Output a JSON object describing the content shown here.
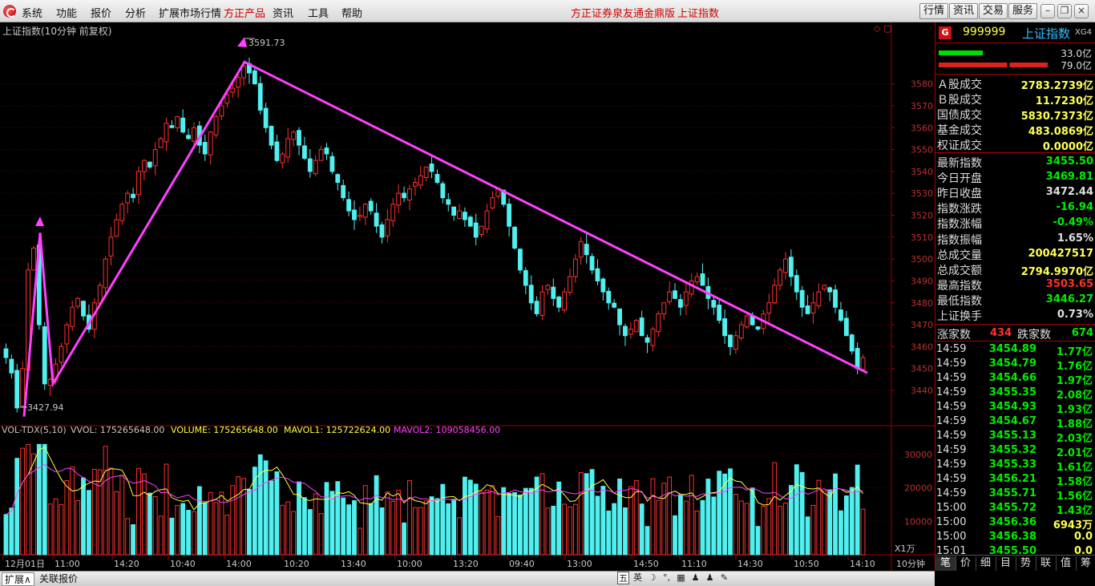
{
  "menu": {
    "items": [
      "系统",
      "功能",
      "报价",
      "分析",
      "扩展市场行情",
      "方正产品",
      "资讯",
      "工具",
      "帮助"
    ],
    "highlight": "方正产品",
    "title_left": "方正证券泉友通金鼎版",
    "title_right": "上证指数",
    "buttons": [
      "行情",
      "资讯",
      "交易",
      "服务"
    ]
  },
  "chart": {
    "title": "上证指数(10分钟 前复权)",
    "high_label": "3591.73",
    "low_label": "3427.94",
    "vol_header": {
      "name": "VOL-TDX(5,10)",
      "vvol": "VVOL: 175265648.00",
      "volume": "VOLUME: 175265648.00",
      "mavol1": "MAVOL1: 125722624.00",
      "mavol2": "MAVOL2: 109058456.00"
    },
    "unit_label": "X1万",
    "period_label": "10分钟",
    "colors": {
      "up": "#ff3030",
      "down": "#50f0f0",
      "trend": "#ff40ff",
      "ma1": "#ffff40",
      "ma2": "#ff40ff",
      "grid": "#6a0000"
    }
  },
  "chart_data": [
    {
      "type": "candlestick",
      "title": "上证指数(10分钟 前复权)",
      "y_ticks": [
        3440,
        3450,
        3460,
        3470,
        3480,
        3490,
        3500,
        3510,
        3520,
        3530,
        3540,
        3550,
        3560,
        3570,
        3580
      ],
      "ylim": [
        3425,
        3600
      ],
      "x_ticks": [
        "12月01日",
        "11:00",
        "14:20",
        "10:40",
        "14:00",
        "10:20",
        "13:40",
        "10:00",
        "13:20",
        "09:40",
        "13:00",
        "14:50",
        "11:10",
        "14:30",
        "10:50",
        "14:10"
      ],
      "close_path": [
        3455,
        3448,
        3432,
        3450,
        3495,
        3505,
        3470,
        3443,
        3445,
        3452,
        3460,
        3470,
        3478,
        3482,
        3474,
        3468,
        3480,
        3488,
        3500,
        3510,
        3518,
        3525,
        3530,
        3528,
        3540,
        3545,
        3542,
        3550,
        3555,
        3562,
        3560,
        3565,
        3558,
        3555,
        3560,
        3552,
        3548,
        3558,
        3565,
        3570,
        3575,
        3578,
        3583,
        3588,
        3585,
        3580,
        3568,
        3560,
        3552,
        3545,
        3548,
        3555,
        3558,
        3552,
        3546,
        3540,
        3545,
        3550,
        3548,
        3540,
        3535,
        3528,
        3522,
        3518,
        3520,
        3525,
        3522,
        3515,
        3510,
        3518,
        3525,
        3530,
        3528,
        3532,
        3535,
        3538,
        3542,
        3540,
        3535,
        3528,
        3525,
        3520,
        3522,
        3518,
        3515,
        3510,
        3515,
        3522,
        3528,
        3532,
        3525,
        3515,
        3505,
        3495,
        3488,
        3480,
        3475,
        3485,
        3488,
        3482,
        3478,
        3485,
        3492,
        3500,
        3508,
        3502,
        3495,
        3490,
        3485,
        3480,
        3478,
        3470,
        3465,
        3468,
        3472,
        3465,
        3462,
        3468,
        3475,
        3480,
        3485,
        3482,
        3478,
        3485,
        3490,
        3492,
        3488,
        3482,
        3478,
        3472,
        3465,
        3460,
        3465,
        3470,
        3474,
        3470,
        3468,
        3475,
        3480,
        3488,
        3495,
        3500,
        3492,
        3485,
        3478,
        3475,
        3480,
        3485,
        3488,
        3485,
        3478,
        3472,
        3465,
        3458,
        3450,
        3455
      ],
      "annotations": [
        "3591.73",
        "3427.94"
      ],
      "last": 3455.5
    },
    {
      "type": "bar",
      "title": "VOL-TDX(5,10)",
      "y_ticks": [
        10000,
        20000,
        30000
      ],
      "unit": "X1万",
      "ylim": [
        0,
        35000
      ]
    }
  ],
  "panel": {
    "code": "999999",
    "name": "上证指数",
    "tag": "XG4",
    "bar_top_value": "33.0亿",
    "bar_bottom_value": "79.0亿",
    "stats": [
      {
        "k": "Ａ股成交",
        "v": "2783.2739亿",
        "c": "y"
      },
      {
        "k": "Ｂ股成交",
        "v": "11.7230亿",
        "c": "y"
      },
      {
        "k": "国债成交",
        "v": "5830.7373亿",
        "c": "y"
      },
      {
        "k": "基金成交",
        "v": "483.0869亿",
        "c": "y"
      },
      {
        "k": "权证成交",
        "v": "0.0000亿",
        "c": "y"
      }
    ],
    "quote": [
      {
        "k": "最新指数",
        "v": "3455.50",
        "c": "g"
      },
      {
        "k": "今日开盘",
        "v": "3469.81",
        "c": "g"
      },
      {
        "k": "昨日收盘",
        "v": "3472.44",
        "c": "w"
      },
      {
        "k": "指数涨跌",
        "v": "-16.94",
        "c": "g"
      },
      {
        "k": "指数涨幅",
        "v": "-0.49%",
        "c": "g"
      },
      {
        "k": "指数振幅",
        "v": "1.65%",
        "c": "w"
      },
      {
        "k": "总成交量",
        "v": "200427517",
        "c": "y"
      },
      {
        "k": "总成交额",
        "v": "2794.9970亿",
        "c": "y"
      },
      {
        "k": "最高指数",
        "v": "3503.65",
        "c": "r"
      },
      {
        "k": "最低指数",
        "v": "3446.27",
        "c": "g"
      },
      {
        "k": "上证换手",
        "v": "0.73%",
        "c": "w"
      }
    ],
    "up_label": "涨家数",
    "up_count": "434",
    "down_label": "跌家数",
    "down_count": "674",
    "ticks": [
      {
        "t": "14:59",
        "p": "3454.89",
        "v": "1.77亿",
        "c": "g"
      },
      {
        "t": "14:59",
        "p": "3454.79",
        "v": "1.76亿",
        "c": "g"
      },
      {
        "t": "14:59",
        "p": "3454.66",
        "v": "1.97亿",
        "c": "g"
      },
      {
        "t": "14:59",
        "p": "3455.35",
        "v": "2.08亿",
        "c": "g"
      },
      {
        "t": "14:59",
        "p": "3454.93",
        "v": "1.93亿",
        "c": "g"
      },
      {
        "t": "14:59",
        "p": "3454.67",
        "v": "1.88亿",
        "c": "g"
      },
      {
        "t": "14:59",
        "p": "3455.13",
        "v": "2.03亿",
        "c": "g"
      },
      {
        "t": "14:59",
        "p": "3455.32",
        "v": "2.01亿",
        "c": "g"
      },
      {
        "t": "14:59",
        "p": "3455.33",
        "v": "1.61亿",
        "c": "g"
      },
      {
        "t": "14:59",
        "p": "3456.21",
        "v": "1.58亿",
        "c": "g"
      },
      {
        "t": "14:59",
        "p": "3455.71",
        "v": "1.56亿",
        "c": "g"
      },
      {
        "t": "15:00",
        "p": "3455.72",
        "v": "1.43亿",
        "c": "g"
      },
      {
        "t": "15:00",
        "p": "3456.36",
        "v": "6943万",
        "c": "y"
      },
      {
        "t": "15:00",
        "p": "3456.38",
        "v": "0.0",
        "c": "y"
      },
      {
        "t": "15:01",
        "p": "3455.50",
        "v": "0.0",
        "c": "y"
      }
    ],
    "tabs": [
      "笔",
      "价",
      "细",
      "目",
      "势",
      "联",
      "值",
      "筹"
    ]
  },
  "statusbar": {
    "tabs": [
      "扩展∧",
      "关联报价"
    ],
    "ime": [
      "五",
      "英",
      "☽",
      "°,",
      "▦",
      "♟",
      "♟",
      "✎"
    ]
  }
}
